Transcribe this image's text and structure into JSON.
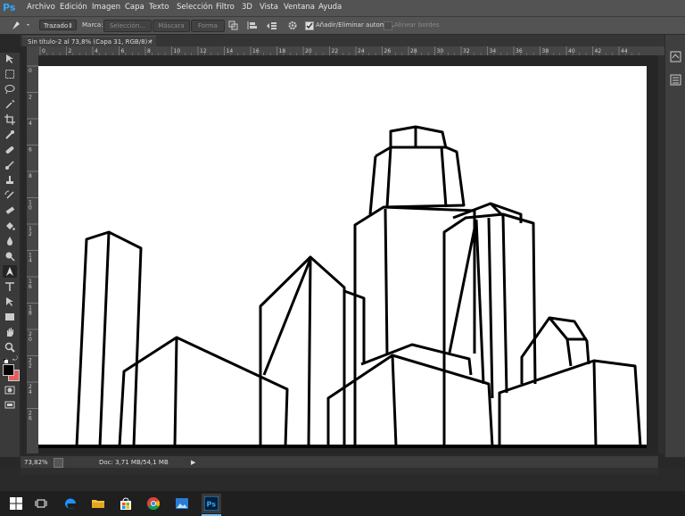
{
  "app": {
    "logo": "Ps"
  },
  "menu": [
    "Archivo",
    "Edición",
    "Imagen",
    "Capa",
    "Texto",
    "Selección",
    "Filtro",
    "3D",
    "Vista",
    "Ventana",
    "Ayuda"
  ],
  "options": {
    "mode_value": "Trazado",
    "marca_label": "Marca:",
    "seleccion_btn": "Selección...",
    "mascara_btn": "Máscara",
    "forma_btn": "Forma",
    "auto_add_label": "Añadir/Eliminar automát.",
    "auto_add_checked": true,
    "align_edges_label": "Alinear bordes",
    "align_edges_checked": false
  },
  "document": {
    "tab_title": "Sin título-2 al 73,8% (Capa 31, RGB/8) *"
  },
  "ruler_top": [
    "0",
    "2",
    "4",
    "6",
    "8",
    "10",
    "12",
    "14",
    "16",
    "18",
    "20",
    "22",
    "24",
    "26",
    "28",
    "30",
    "32",
    "34",
    "36",
    "38",
    "40",
    "42",
    "44"
  ],
  "ruler_left": [
    "0",
    "2",
    "4",
    "6",
    "8",
    "1\n0",
    "1\n2",
    "1\n4",
    "1\n6",
    "1\n8",
    "2\n0",
    "2\n2",
    "2\n4",
    "2\n6"
  ],
  "status": {
    "zoom": "73,82%",
    "doc_info": "Doc: 3,71 MB/54,1 MB"
  },
  "colors": {
    "foreground": "#000000",
    "background": "#e45e5e",
    "ps_blue": "#31a8ff"
  },
  "tools": [
    "move-tool",
    "marquee-tool",
    "lasso-tool",
    "magic-wand-tool",
    "crop-tool",
    "eyedropper-tool",
    "healing-brush-tool",
    "brush-tool",
    "clone-stamp-tool",
    "history-brush-tool",
    "eraser-tool",
    "paint-bucket-tool",
    "blur-tool",
    "dodge-tool",
    "pen-tool",
    "type-tool",
    "path-selection-tool",
    "rectangle-tool",
    "hand-tool",
    "zoom-tool"
  ],
  "taskbar": [
    "windows-start",
    "task-view",
    "edge",
    "file-explorer",
    "store",
    "chrome",
    "photos",
    "photoshop"
  ]
}
